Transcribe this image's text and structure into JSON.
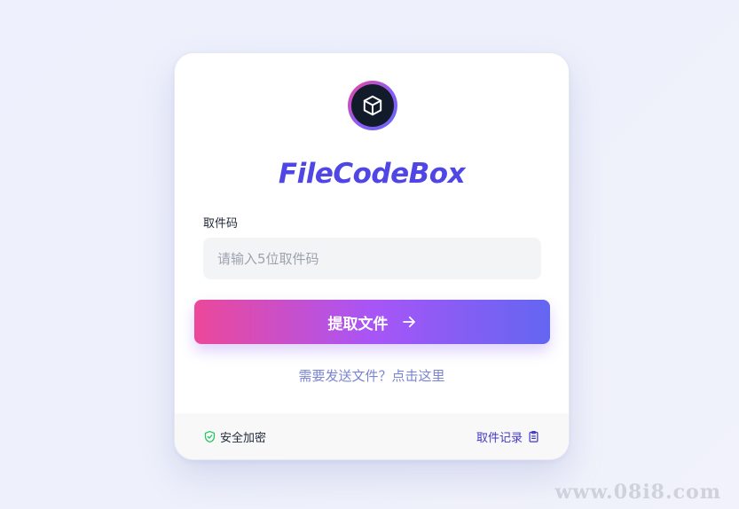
{
  "app": {
    "title": "FileCodeBox"
  },
  "form": {
    "label": "取件码",
    "placeholder": "请输入5位取件码",
    "submit_label": "提取文件",
    "send_link": "需要发送文件？点击这里"
  },
  "footer": {
    "secure_label": "安全加密",
    "history_label": "取件记录"
  },
  "icons": {
    "logo": "cube-icon",
    "submit": "arrow-right-icon",
    "secure": "shield-check-icon",
    "history": "clipboard-icon"
  },
  "colors": {
    "brand": "#4f46e5",
    "gradient_start": "#ec4899",
    "gradient_mid": "#a855f7",
    "gradient_end": "#6366f1",
    "secure": "#22c55e"
  },
  "watermark": "www.08i8.com"
}
